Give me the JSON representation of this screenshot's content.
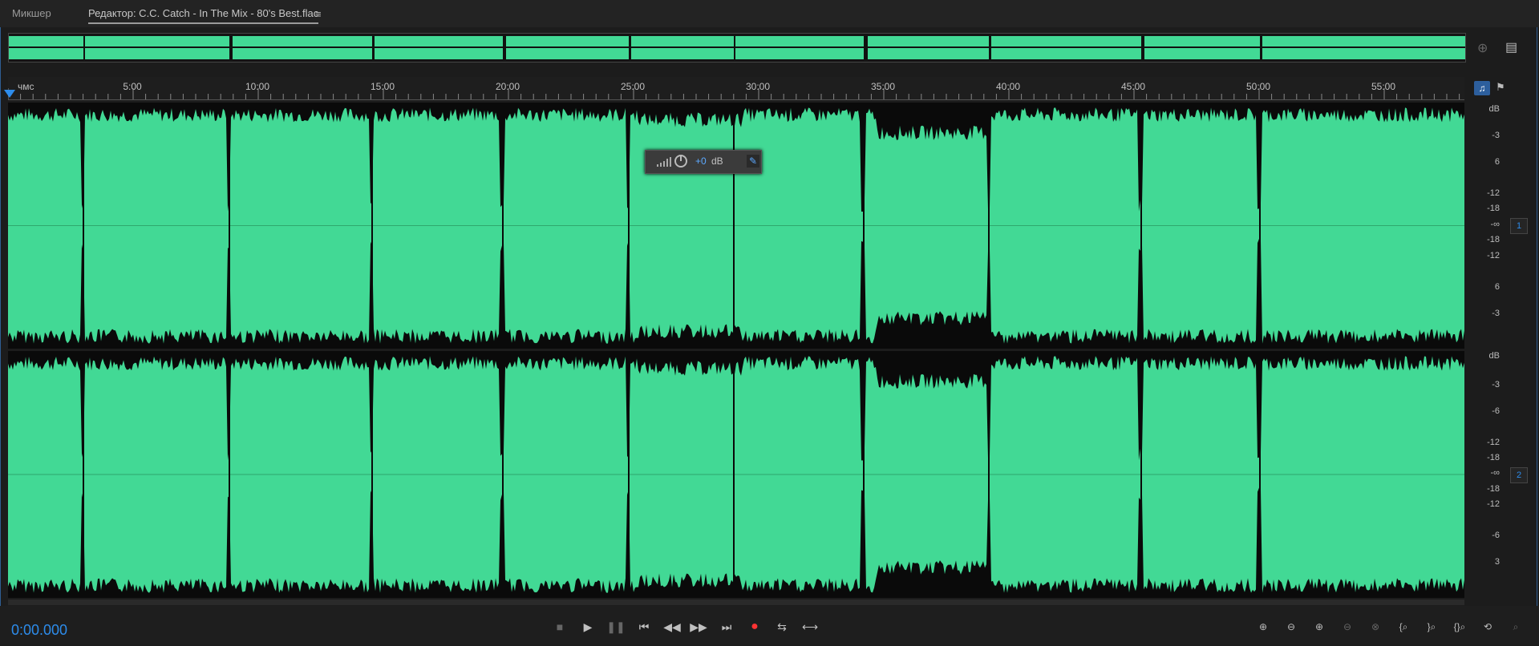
{
  "tabs": {
    "mixer": "Микшер",
    "editor": "Редактор: C.C. Catch - In The Mix - 80's Best.flac",
    "menu_icon": "≡"
  },
  "ruler": {
    "unit": "чмс",
    "labels": [
      "5:00",
      "10:00",
      "15:00",
      "20:00",
      "25:00",
      "30:00",
      "35:00",
      "40:00",
      "45:00",
      "50:00",
      "55:00"
    ]
  },
  "channels": {
    "ch1": {
      "badge": "1",
      "db_labels": [
        "dB",
        "-3",
        "6",
        "-12",
        "-18",
        "-∞",
        "-18",
        "-12",
        "6",
        "-3"
      ]
    },
    "ch2": {
      "badge": "2",
      "db_labels": [
        "dB",
        "-3",
        "-6",
        "-12",
        "-18",
        "-∞",
        "-18",
        "-12",
        "-6",
        "3"
      ]
    }
  },
  "hud": {
    "value": "+0",
    "unit": "dB"
  },
  "transport": {
    "time": "0:00.000",
    "buttons": [
      "stop",
      "play",
      "pause",
      "to-start",
      "rewind",
      "fast-forward",
      "to-end",
      "record",
      "loop",
      "skip"
    ]
  },
  "zoom_buttons": [
    "zoom-in-amplitude",
    "zoom-out-amplitude",
    "zoom-in-time",
    "zoom-out-time",
    "zoom-out-full",
    "zoom-in-left",
    "zoom-in-right",
    "zoom-selection",
    "zoom-full",
    "zoom-reset"
  ],
  "colors": {
    "wave": "#42d995",
    "accent": "#2d8ceb",
    "background": "#1c1c1c"
  }
}
